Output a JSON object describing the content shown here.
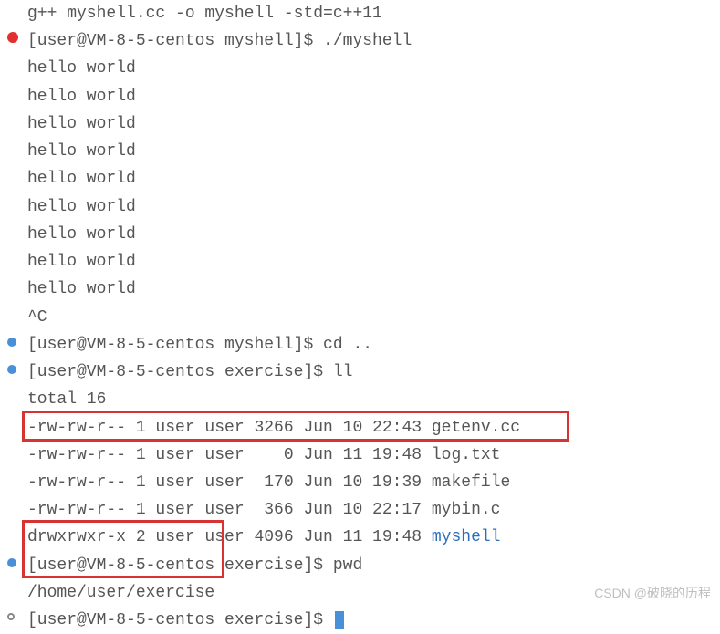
{
  "lines": {
    "l0": "g++ myshell.cc -o myshell -std=c++11",
    "l1": "[user@VM-8-5-centos myshell]$ ./myshell",
    "l2": "hello world",
    "l3": "hello world",
    "l4": "hello world",
    "l5": "hello world",
    "l6": "hello world",
    "l7": "hello world",
    "l8": "hello world",
    "l9": "hello world",
    "l10": "hello world",
    "l11": "^C",
    "l12": "[user@VM-8-5-centos myshell]$ cd ..",
    "l13": "[user@VM-8-5-centos exercise]$ ll",
    "l14": "total 16",
    "l15": "-rw-rw-r-- 1 user user 3266 Jun 10 22:43 getenv.cc",
    "l16": "-rw-rw-r-- 1 user user    0 Jun 11 19:48 log.txt",
    "l17": "-rw-rw-r-- 1 user user  170 Jun 10 19:39 makefile",
    "l18": "-rw-rw-r-- 1 user user  366 Jun 10 22:17 mybin.c",
    "l19_a": "drwxrwxr-x 2 user user 4096 Jun 11 19:48 ",
    "l19_b": "myshell",
    "l20": "[user@VM-8-5-centos exercise]$ pwd",
    "l21": "/home/user/exercise",
    "l22": "[user@VM-8-5-centos exercise]$ "
  },
  "watermark": "CSDN @破晓的历程"
}
